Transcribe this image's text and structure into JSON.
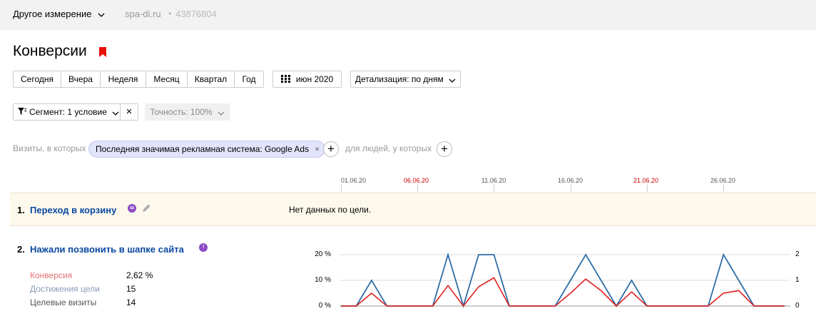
{
  "topbar": {
    "dimension_label": "Другое измерение",
    "site": "spa-di.ru",
    "separator": "•",
    "counter_id": "43876804"
  },
  "page": {
    "title": "Конверсии"
  },
  "period_buttons": [
    "Сегодня",
    "Вчера",
    "Неделя",
    "Месяц",
    "Квартал",
    "Год"
  ],
  "date_picker": {
    "label": "июн 2020"
  },
  "detail": {
    "label": "Детализация: по дням"
  },
  "segment": {
    "label": "Сегмент: 1 условие",
    "clear": "×"
  },
  "accuracy": {
    "label": "Точность: 100%"
  },
  "filter": {
    "prefix": "Визиты, в которых",
    "chip": "Последняя значимая рекламная система: Google Ads",
    "chip_remove": "×",
    "people_label": "для людей, у которых",
    "add": "+"
  },
  "timeline": {
    "dates": [
      {
        "label": "01.06.20",
        "weekend": false
      },
      {
        "label": "06.06.20",
        "weekend": true
      },
      {
        "label": "11.06.20",
        "weekend": false
      },
      {
        "label": "16.06.20",
        "weekend": false
      },
      {
        "label": "21.06.20",
        "weekend": true
      },
      {
        "label": "26.06.20",
        "weekend": false
      }
    ]
  },
  "goals": [
    {
      "num": "1.",
      "name": "Переход в корзину",
      "badge": "ш",
      "status": "Нет данных по цели."
    },
    {
      "num": "2.",
      "name": "Нажали позвонить в шапке сайта",
      "badge": "!",
      "metrics": [
        {
          "label": "Конверсия",
          "value": "2,62 %",
          "color": "#e07070"
        },
        {
          "label": "Достижения цели",
          "value": "15",
          "color": "#8a9ab8"
        },
        {
          "label": "Целевые визиты",
          "value": "14",
          "color": "#555555"
        }
      ]
    }
  ],
  "chart_data": {
    "type": "line",
    "x": [
      "01.06.20",
      "02.06.20",
      "03.06.20",
      "04.06.20",
      "05.06.20",
      "06.06.20",
      "07.06.20",
      "08.06.20",
      "09.06.20",
      "10.06.20",
      "11.06.20",
      "12.06.20",
      "13.06.20",
      "14.06.20",
      "15.06.20",
      "16.06.20",
      "17.06.20",
      "18.06.20",
      "19.06.20",
      "20.06.20",
      "21.06.20",
      "22.06.20",
      "23.06.20",
      "24.06.20",
      "25.06.20",
      "26.06.20",
      "27.06.20",
      "28.06.20",
      "29.06.20",
      "30.06.20"
    ],
    "left_axis": {
      "ticks": [
        "20 %",
        "10 %",
        "0 %"
      ],
      "range": [
        0,
        20
      ]
    },
    "right_axis": {
      "ticks": [
        "2",
        "1",
        "0"
      ],
      "range": [
        0,
        2
      ]
    },
    "series": [
      {
        "color": "#2e6ea6",
        "axis": "right",
        "values": [
          0,
          0,
          1,
          0,
          0,
          0,
          0,
          2,
          0,
          2,
          2,
          0,
          0,
          0,
          0,
          1,
          2,
          1,
          0,
          1,
          0,
          0,
          0,
          0,
          0,
          2,
          1,
          0,
          0,
          0
        ]
      },
      {
        "color": "#e02020",
        "axis": "left",
        "values": [
          0,
          0,
          5,
          0,
          0,
          0,
          0,
          8,
          0,
          7.5,
          11,
          0,
          0,
          0,
          0,
          5,
          10.5,
          6,
          0,
          5.5,
          0,
          0,
          0,
          0,
          0,
          5,
          6,
          0,
          0,
          0
        ]
      }
    ]
  },
  "colors": {
    "link": "#0a48a0",
    "bookmark": "#e8100a",
    "chip_bg": "#e2e4fb",
    "row_highlight": "#fcf8ec",
    "weekend": "#cc0000"
  },
  "icons": {
    "dimension_chevron": "chevron-down-icon",
    "bookmark": "bookmark-icon",
    "calendar": "calendar-icon",
    "segment_filter": "filter-icon",
    "pencil": "pencil-icon",
    "goal_badge": "goal-type-icon"
  }
}
